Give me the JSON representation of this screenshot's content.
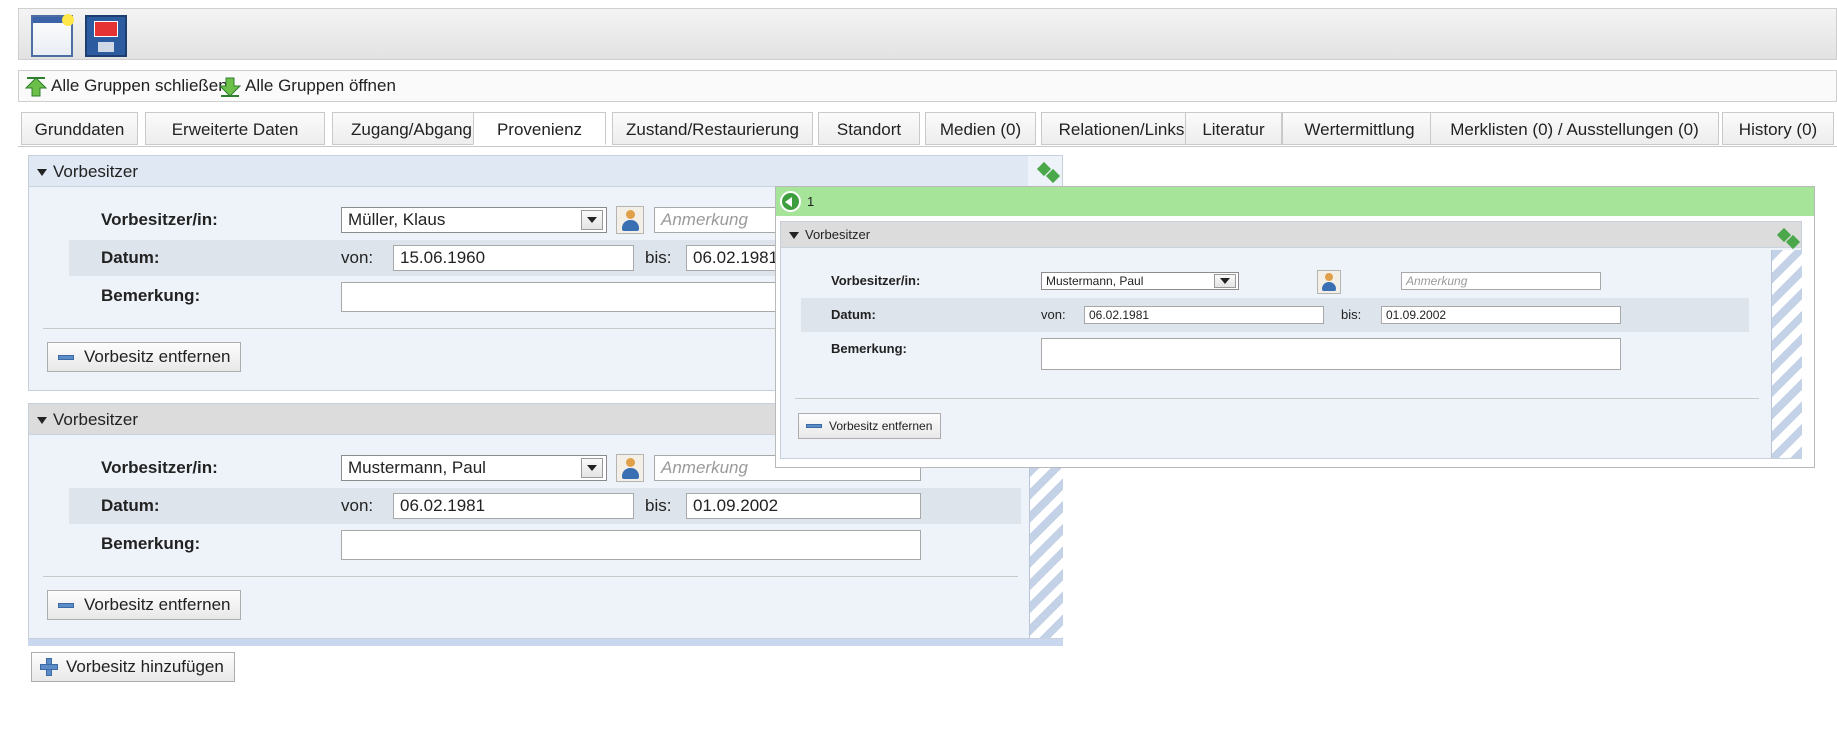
{
  "toolbar": {
    "new_icon": "new-document-icon",
    "save_icon": "save-disk-icon"
  },
  "groups": {
    "collapse_label": "Alle Gruppen schließen",
    "expand_label": "Alle Gruppen öffnen"
  },
  "tabs": [
    {
      "label": "Grunddaten"
    },
    {
      "label": "Erweiterte Daten"
    },
    {
      "label": "Zugang/Abgang"
    },
    {
      "label": "Provenienz"
    },
    {
      "label": "Zustand/Restaurierung"
    },
    {
      "label": "Standort"
    },
    {
      "label": "Medien (0)"
    },
    {
      "label": "Relationen/Links"
    },
    {
      "label": "Literatur"
    },
    {
      "label": "Wertermittlung"
    },
    {
      "label": "Merklisten (0) / Ausstellungen (0)"
    },
    {
      "label": "History (0)"
    }
  ],
  "active_tab": "Provenienz",
  "sections": [
    {
      "title": "Vorbesitzer",
      "owner_label": "Vorbesitzer/in:",
      "owner_value": "Müller, Klaus",
      "note_placeholder": "Anmerkung",
      "date_label": "Datum:",
      "from_label": "von:",
      "from_value": "15.06.1960",
      "to_label": "bis:",
      "to_value": "06.02.1981",
      "remark_label": "Bemerkung:",
      "remark_value": "",
      "remove_label": "Vorbesitz entfernen"
    },
    {
      "title": "Vorbesitzer",
      "owner_label": "Vorbesitzer/in:",
      "owner_value": "Mustermann, Paul",
      "note_placeholder": "Anmerkung",
      "date_label": "Datum:",
      "from_label": "von:",
      "from_value": "06.02.1981",
      "to_label": "bis:",
      "to_value": "01.09.2002",
      "remark_label": "Bemerkung:",
      "remark_value": "",
      "remove_label": "Vorbesitz entfernen"
    }
  ],
  "add_label": "Vorbesitz hinzufügen",
  "overlay": {
    "counter": "1",
    "title": "Vorbesitzer",
    "owner_label": "Vorbesitzer/in:",
    "owner_value": "Mustermann, Paul",
    "note_placeholder": "Anmerkung",
    "date_label": "Datum:",
    "from_label": "von:",
    "from_value": "06.02.1981",
    "to_label": "bis:",
    "to_value": "01.09.2002",
    "remark_label": "Bemerkung:",
    "remove_label": "Vorbesitz entfernen"
  },
  "colors": {
    "overlay_header": "#a6e49a",
    "panel_bg": "#eef3f9",
    "accent_blue": "#5b8cc8"
  }
}
